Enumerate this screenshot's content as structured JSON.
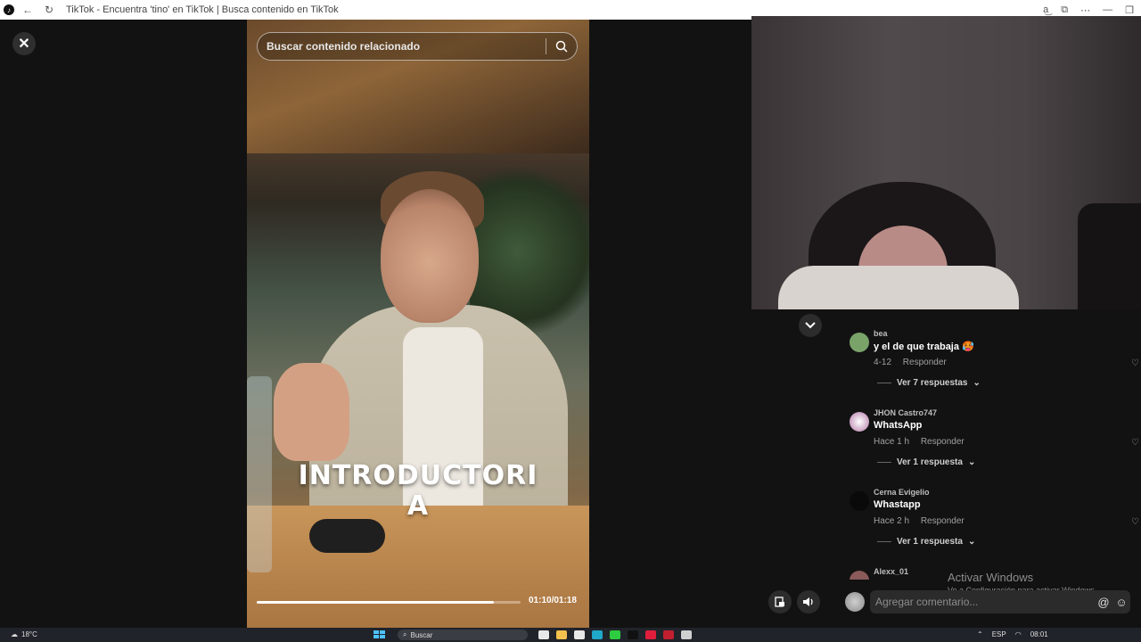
{
  "window": {
    "title": "TikTok - Encuentra 'tino' en TikTok | Busca contenido en TikTok"
  },
  "search": {
    "placeholder": "Buscar contenido relacionado"
  },
  "video": {
    "caption_line1": "INTRODUCTORI",
    "caption_line2": "A",
    "time": "01:10/01:18",
    "progress": 0.9
  },
  "comments": [
    {
      "user": "bea",
      "text": "y el de que trabaja 🥵",
      "date": "4-12",
      "reply": "Responder",
      "replies": "Ver 7 respuestas",
      "avatar_color": "#7aa36a"
    },
    {
      "user": "JHON Castro747",
      "text": "WhatsApp",
      "date": "Hace 1 h",
      "reply": "Responder",
      "replies": "Ver 1 respuesta",
      "avatar_color": "#e8e1e6"
    },
    {
      "user": "Cerna Evigelio",
      "text": "Whastapp",
      "date": "Hace 2 h",
      "reply": "Responder",
      "replies": "Ver 1 respuesta",
      "avatar_color": "#0a0a0a"
    },
    {
      "user": "Alexx_01",
      "avatar_color": "#8a5a5a"
    }
  ],
  "comment_input": {
    "placeholder": "Agregar comentario..."
  },
  "watermark": {
    "line1": "Activar Windows",
    "line2": "Ve a Configuración para activar Windows."
  },
  "taskbar": {
    "temperature": "18°C",
    "search": "Buscar",
    "language": "ESP",
    "time": "08:01"
  },
  "colors": {
    "background": "#121212",
    "taskbar": "#20232a",
    "accent": "#fe2c55"
  }
}
